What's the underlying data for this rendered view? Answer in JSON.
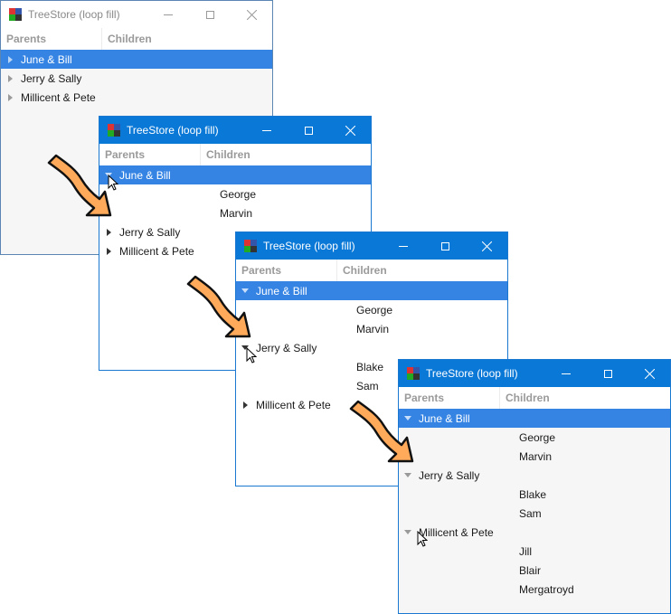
{
  "windows": [
    {
      "title": "TreeStore (loop fill)",
      "state": "inactive",
      "columns": [
        "Parents",
        "Children"
      ],
      "rows": [
        {
          "parent": "June & Bill",
          "expanded": false,
          "selected": true
        },
        {
          "parent": "Jerry & Sally",
          "expanded": false,
          "selected": false
        },
        {
          "parent": "Millicent & Pete",
          "expanded": false,
          "selected": false
        }
      ]
    },
    {
      "title": "TreeStore (loop fill)",
      "state": "active",
      "columns": [
        "Parents",
        "Children"
      ],
      "rows": [
        {
          "parent": "June & Bill",
          "expanded": true,
          "selected": true,
          "children": [
            "George",
            "Marvin"
          ]
        },
        {
          "parent": "Jerry & Sally",
          "expanded": false,
          "selected": false
        },
        {
          "parent": "Millicent & Pete",
          "expanded": false,
          "selected": false
        }
      ]
    },
    {
      "title": "TreeStore (loop fill)",
      "state": "active",
      "columns": [
        "Parents",
        "Children"
      ],
      "rows": [
        {
          "parent": "June & Bill",
          "expanded": true,
          "selected": true,
          "children": [
            "George",
            "Marvin"
          ]
        },
        {
          "parent": "Jerry & Sally",
          "expanded": true,
          "selected": false,
          "children": [
            "Blake",
            "Sam"
          ]
        },
        {
          "parent": "Millicent & Pete",
          "expanded": false,
          "selected": false
        }
      ]
    },
    {
      "title": "TreeStore (loop fill)",
      "state": "active",
      "columns": [
        "Parents",
        "Children"
      ],
      "rows": [
        {
          "parent": "June & Bill",
          "expanded": true,
          "selected": true,
          "children": [
            "George",
            "Marvin"
          ]
        },
        {
          "parent": "Jerry & Sally",
          "expanded": true,
          "selected": false,
          "children": [
            "Blake",
            "Sam"
          ]
        },
        {
          "parent": "Millicent & Pete",
          "expanded": true,
          "selected": false,
          "children": [
            "Jill",
            "Blair",
            "Mergatroyd"
          ]
        }
      ]
    }
  ],
  "icons": {
    "app": "gtk-cube-icon",
    "minimize": "minimize-icon",
    "maximize": "maximize-icon",
    "close": "close-icon",
    "arrow": "curved-arrow-icon",
    "cursor": "mouse-cursor-icon"
  },
  "colors": {
    "titlebar_active": "#0a78d7",
    "selection": "#3584e4",
    "arrow_fill": "#ffaa5a",
    "list_background": "#f6f6f6"
  }
}
